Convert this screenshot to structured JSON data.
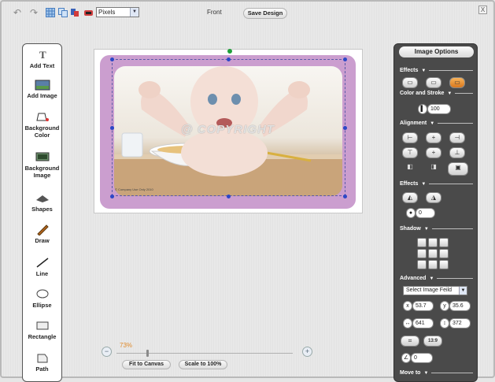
{
  "toolbar": {
    "icons": [
      "undo-icon",
      "redo-icon",
      "grid-icon",
      "copy-icon",
      "layers-icon",
      "eraser-icon"
    ],
    "units_value": "Pixels",
    "side_label": "Front",
    "save_label": "Save Design",
    "close_label": "X"
  },
  "tools": [
    {
      "name": "text",
      "label": "Add Text"
    },
    {
      "name": "image",
      "label": "Add Image"
    },
    {
      "name": "bgcolor",
      "label": "Background Color"
    },
    {
      "name": "bgimage",
      "label": "Background Image"
    },
    {
      "name": "shapes",
      "label": "Shapes"
    },
    {
      "name": "draw",
      "label": "Draw"
    },
    {
      "name": "line",
      "label": "Line"
    },
    {
      "name": "ellipse",
      "label": "Ellipse"
    },
    {
      "name": "rectangle",
      "label": "Rectangle"
    },
    {
      "name": "path",
      "label": "Path"
    }
  ],
  "canvas": {
    "watermark": "@ COPYRIGHT",
    "small_copy": "© Company Use Only 2010"
  },
  "zoom": {
    "percent": "73%",
    "fit_label": "Fit to Canvas",
    "scale_label": "Scale to 100%"
  },
  "options": {
    "title": "Image Options",
    "sections": {
      "effects1": "Effects",
      "color_stroke": "Color and Stroke",
      "alignment": "Alignment",
      "effects2": "Effects",
      "shadow": "Shadow",
      "advanced": "Advanced",
      "move_to": "Move to"
    },
    "opacity_value": "100",
    "blur_value": "0",
    "image_field_select": "Select Image Feild",
    "x_label": "x",
    "x_value": "53.7",
    "y_label": "y",
    "y_value": "35.6",
    "width_value": "641",
    "height_value": "372",
    "ratio_label": "13:9",
    "angle_value": "0"
  }
}
